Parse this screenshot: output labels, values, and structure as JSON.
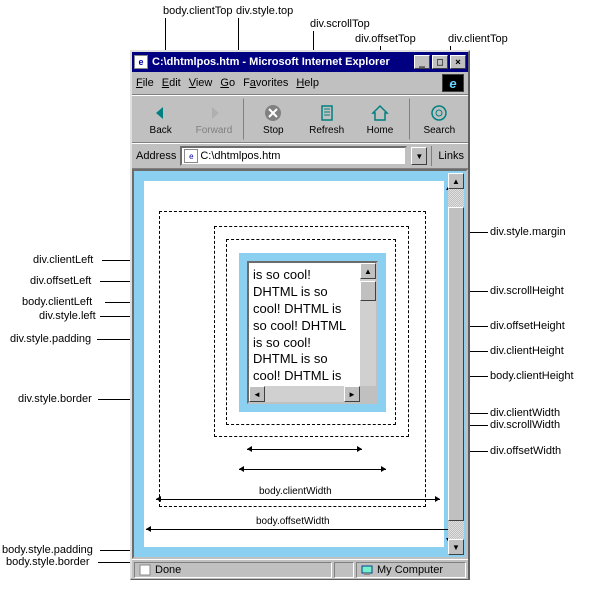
{
  "window": {
    "title": "C:\\dhtmlpos.htm - Microsoft Internet Explorer",
    "min_icon": "_",
    "max_icon": "□",
    "close_icon": "×"
  },
  "menu": {
    "file": "File",
    "edit": "Edit",
    "view": "View",
    "go": "Go",
    "favorites": "Favorites",
    "help": "Help",
    "logo_glyph": "e"
  },
  "toolbar": {
    "back": "Back",
    "forward": "Forward",
    "stop": "Stop",
    "refresh": "Refresh",
    "home": "Home",
    "search": "Search"
  },
  "address": {
    "label": "Address",
    "value": "C:\\dhtmlpos.htm",
    "links": "Links"
  },
  "content": {
    "text": "is so cool! DHTML is so cool! DHTML is so cool! DHTML is so cool! DHTML is so cool! DHTML is"
  },
  "status": {
    "done": "Done",
    "zone": "My Computer"
  },
  "labels": {
    "body_clientTop": "body.clientTop",
    "div_style_top": "div.style.top",
    "div_scrollTop": "div.scrollTop",
    "div_offsetTop": "div.offsetTop",
    "div_clientTop": "div.clientTop",
    "div_style_margin": "div.style.margin",
    "div_clientLeft": "div.clientLeft",
    "div_offsetLeft": "div.offsetLeft",
    "body_clientLeft": "body.clientLeft",
    "div_style_left": "div.style.left",
    "div_style_padding": "div.style.padding",
    "div_style_border": "div.style.border",
    "div_scrollHeight": "div.scrollHeight",
    "div_offsetHeight": "div.offsetHeight",
    "div_clientHeight": "div.clientHeight",
    "body_clientHeight": "body.clientHeight",
    "div_clientWidth": "div.clientWidth",
    "div_scrollWidth": "div.scrollWidth",
    "div_offsetWidth": "div.offsetWidth",
    "body_clientWidth": "body.clientWidth",
    "body_offsetWidth": "body.offsetWidth",
    "body_style_padding": "body.style.padding",
    "body_style_border": "body.style.border"
  }
}
